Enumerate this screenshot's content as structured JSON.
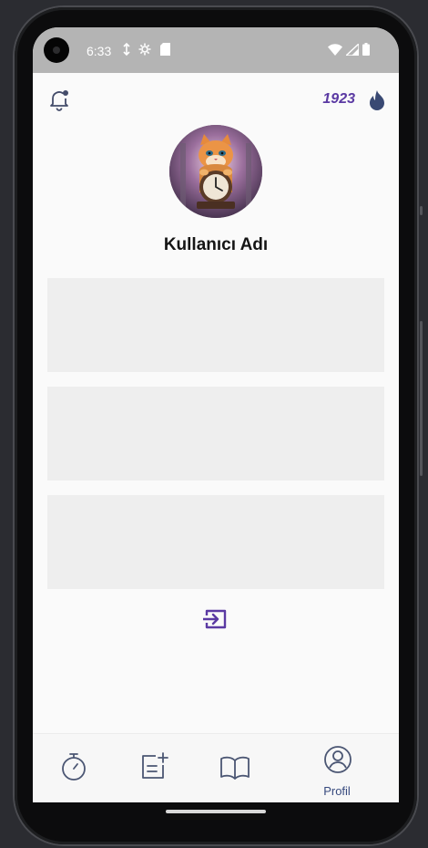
{
  "status_bar": {
    "time": "6:33",
    "left_icons": [
      "network-arrow-icon",
      "settings-gear-icon",
      "sd-card-icon"
    ],
    "right_icons": [
      "wifi-icon",
      "signal-icon",
      "battery-icon"
    ]
  },
  "header": {
    "score": "1923",
    "left_icon": "bell-icon",
    "right_icon": "flame-icon"
  },
  "profile": {
    "username": "Kullanıcı Adı",
    "avatar": "cat-clock-avatar"
  },
  "cards": [
    {
      "id": "card-1"
    },
    {
      "id": "card-2"
    },
    {
      "id": "card-3"
    }
  ],
  "logout_icon": "logout-icon",
  "bottom_nav": {
    "items": [
      {
        "icon": "stopwatch-icon",
        "label": ""
      },
      {
        "icon": "note-add-icon",
        "label": ""
      },
      {
        "icon": "book-icon",
        "label": ""
      },
      {
        "icon": "profile-icon",
        "label": "Profil",
        "active": true
      }
    ]
  },
  "colors": {
    "accent": "#5b3aa3",
    "nav_active": "#374a7e",
    "card": "#eeeeee",
    "status_bar": "#b4b4b4"
  }
}
